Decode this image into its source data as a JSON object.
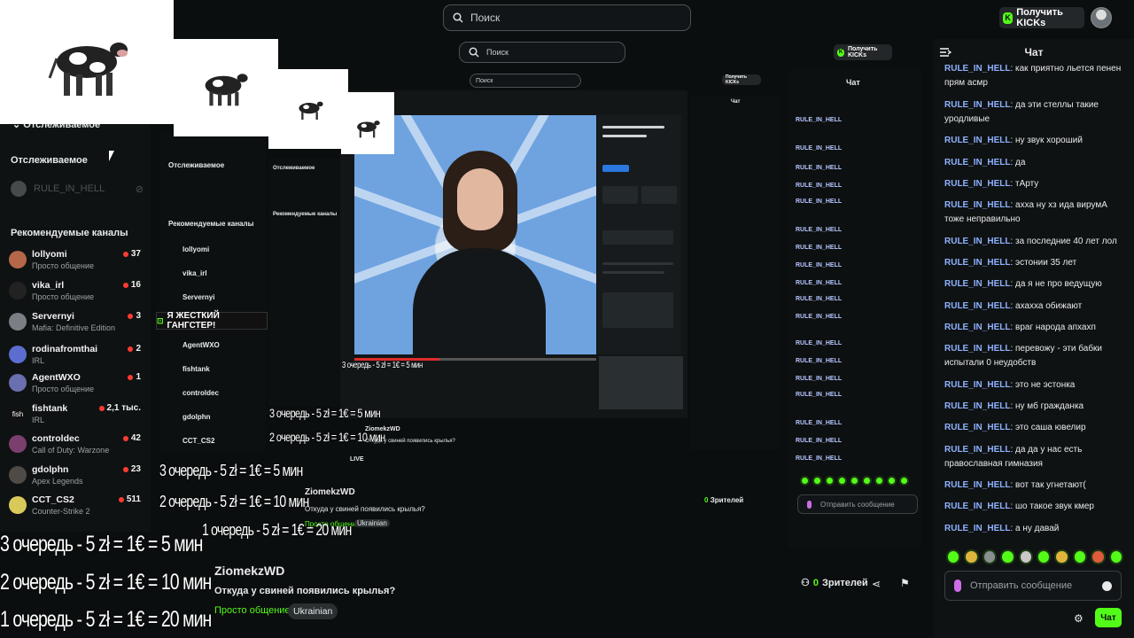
{
  "header": {
    "search_placeholder": "Поиск",
    "kicks_label": "Получить KICKs"
  },
  "sidebar": {
    "section_top": "Отслеживаемое",
    "section_top_collapsed": "Отслеживаемое",
    "followed": [
      {
        "name": "RULE_IN_HELL"
      }
    ],
    "recommended_title": "Рекомендуемые каналы",
    "channels": [
      {
        "name": "lollyomi",
        "category": "Просто общение",
        "viewers": "37"
      },
      {
        "name": "vika_irl",
        "category": "Просто общение",
        "viewers": "16"
      },
      {
        "name": "Servernyi",
        "category": "Mafia: Definitive Edition",
        "viewers": "3"
      },
      {
        "name": "rodinafromthai",
        "category": "IRL",
        "viewers": "2"
      },
      {
        "name": "AgentWXO",
        "category": "Просто общение",
        "viewers": "1"
      },
      {
        "name": "fishtank",
        "category": "IRL",
        "viewers": "2,1 тыс."
      },
      {
        "name": "controldec",
        "category": "Call of Duty: Warzone",
        "viewers": "42"
      },
      {
        "name": "gdolphn",
        "category": "Apex Legends",
        "viewers": "23"
      },
      {
        "name": "CCT_CS2",
        "category": "Counter-Strike 2",
        "viewers": "511"
      }
    ]
  },
  "banner": {
    "text": "Я ЖЕСТКИЙ ГАНГСТЕР!"
  },
  "queue_lines": [
    "3 очередь - 5 zł = 1€ = 5 мин",
    "2 очередь - 5 zł = 1€ = 10 мин",
    "1 очередь - 5 zł = 1€ = 20 мин"
  ],
  "stream": {
    "streamer": "ZiomekzWD",
    "title": "Откуда у свиней появились крылья?",
    "category": "Просто общение",
    "tag": "Ukrainian",
    "viewers": "0",
    "viewers_label": "Зрителей",
    "live_label": "LIVE"
  },
  "chat": {
    "title": "Чат",
    "input_placeholder": "Отправить сообщение",
    "send_label": "Чат",
    "messages": [
      {
        "user": "RULE_IN_HELL",
        "text": ": как приятно льется пенен прям асмр"
      },
      {
        "user": "RULE_IN_HELL",
        "text": ": да эти стеллы такие уродливые"
      },
      {
        "user": "RULE_IN_HELL",
        "text": ": ну звук хороший"
      },
      {
        "user": "RULE_IN_HELL",
        "text": ": да"
      },
      {
        "user": "RULE_IN_HELL",
        "text": ": тАрту"
      },
      {
        "user": "RULE_IN_HELL",
        "text": ": ахха ну хз ида вирумА тоже неправильно"
      },
      {
        "user": "RULE_IN_HELL",
        "text": ": за последние 40 лет лол"
      },
      {
        "user": "RULE_IN_HELL",
        "text": ": эстонии 35 лет"
      },
      {
        "user": "RULE_IN_HELL",
        "text": ": да я не про ведущую"
      },
      {
        "user": "RULE_IN_HELL",
        "text": ": ахахха обижают"
      },
      {
        "user": "RULE_IN_HELL",
        "text": ": враг народа апхахп"
      },
      {
        "user": "RULE_IN_HELL",
        "text": ": перевожу - эти бабки испытали 0 неудобств"
      },
      {
        "user": "RULE_IN_HELL",
        "text": ": это не эстонка"
      },
      {
        "user": "RULE_IN_HELL",
        "text": ": ну мб гражданка"
      },
      {
        "user": "RULE_IN_HELL",
        "text": ": это саша ювелир"
      },
      {
        "user": "RULE_IN_HELL",
        "text": ": да да у нас есть православная гимназия"
      },
      {
        "user": "RULE_IN_HELL",
        "text": ": вот так угнетают("
      },
      {
        "user": "RULE_IN_HELL",
        "text": ": шо такое звук кмер"
      },
      {
        "user": "RULE_IN_HELL",
        "text": ": а ну давай"
      }
    ]
  },
  "colors": {
    "accent": "#53fc18",
    "username": "#8fb2ff",
    "background": "#0b0e0f",
    "panel": "#0f1213"
  },
  "icons": [
    "search-icon",
    "kick-logo-icon",
    "avatar",
    "chat-collapse-icon",
    "mic-icon",
    "emoji-icon",
    "gear-icon",
    "share-icon",
    "gift-icon",
    "person-icon"
  ]
}
